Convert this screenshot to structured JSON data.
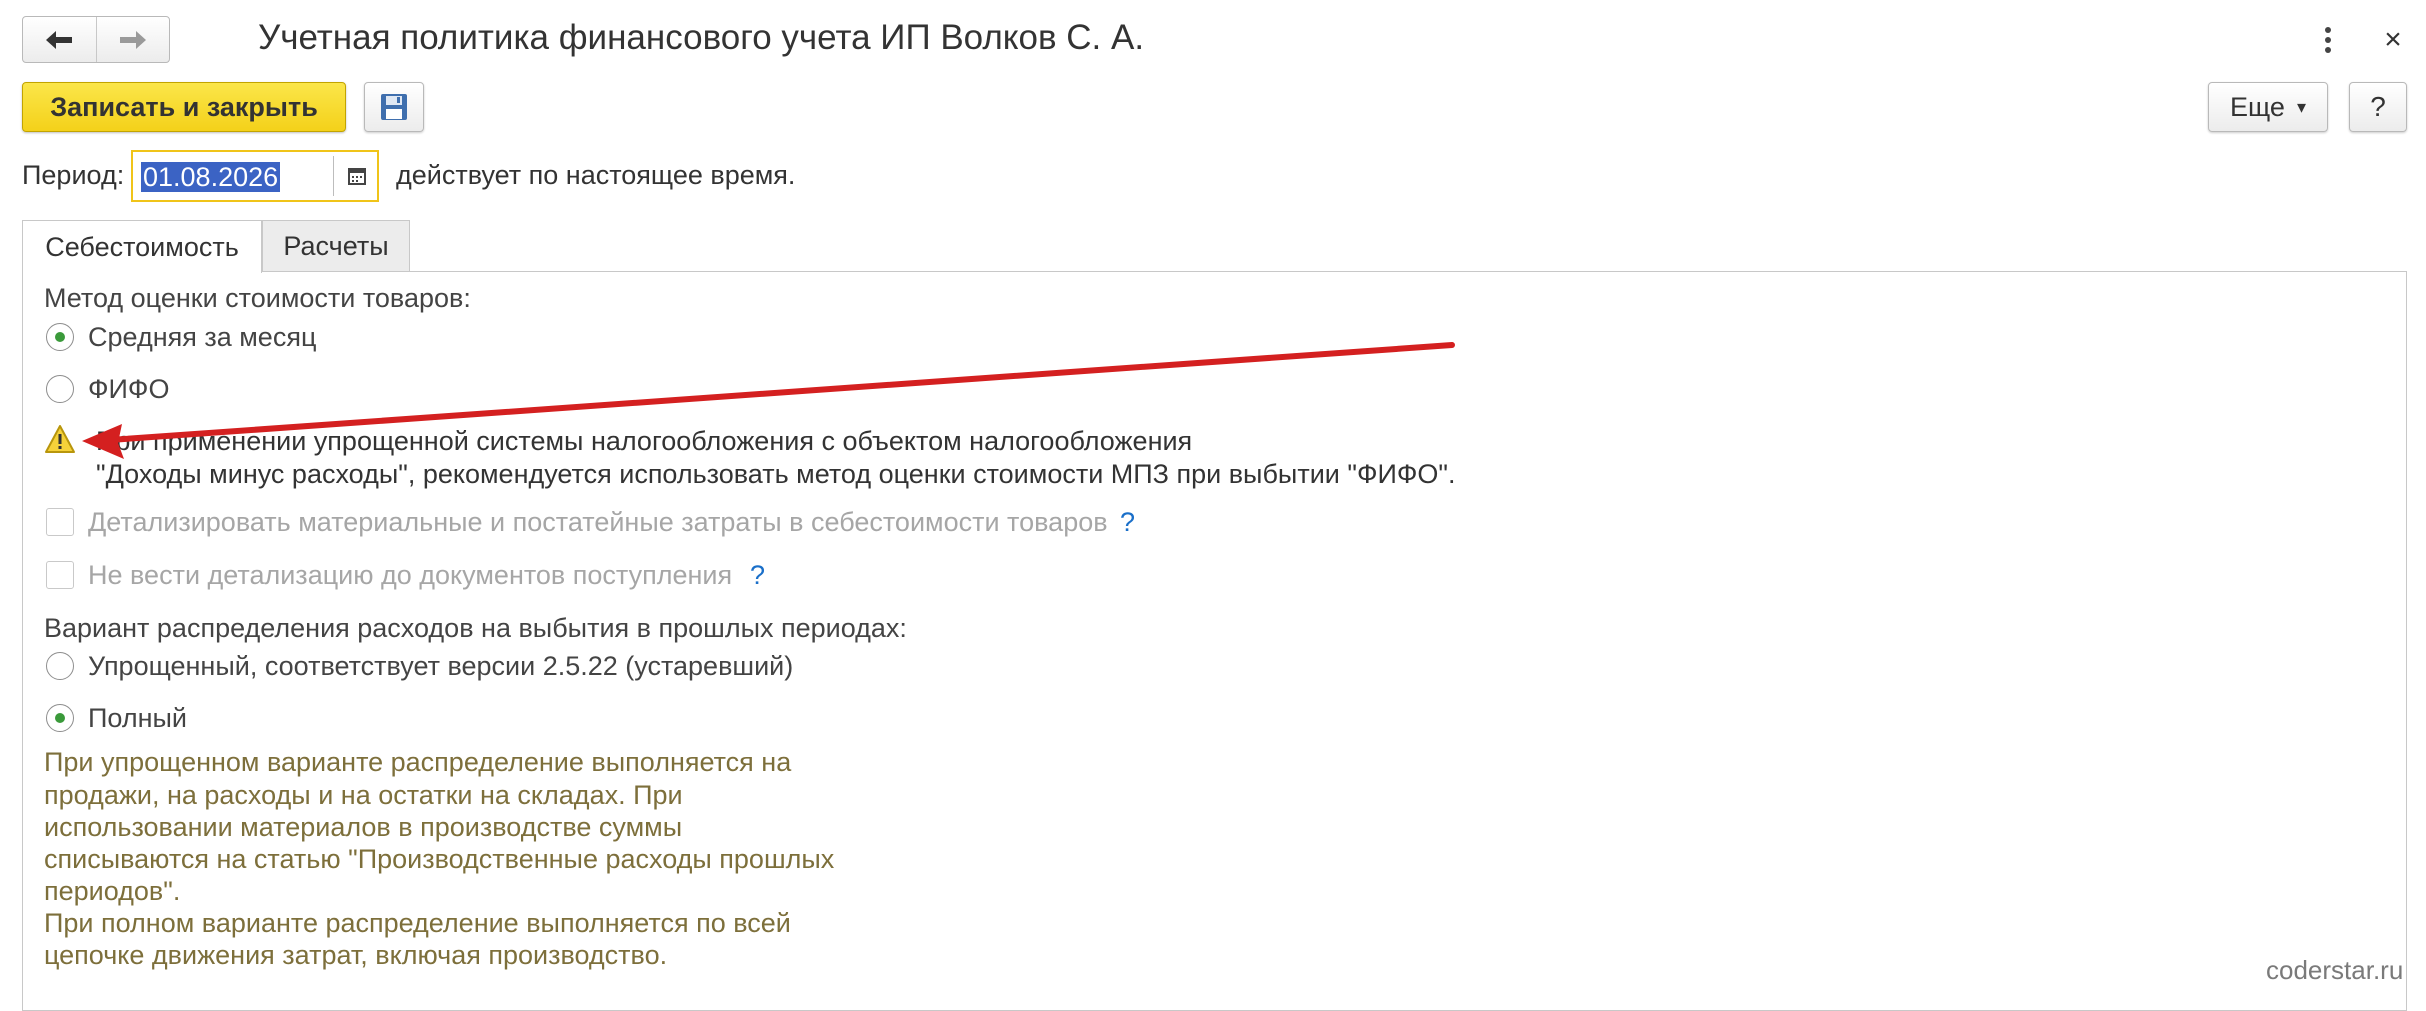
{
  "window": {
    "title": "Учетная политика финансового учета ИП Волков С. А.",
    "close_glyph": "×"
  },
  "toolbar": {
    "save_close_label": "Записать и закрыть",
    "more_label": "Еще",
    "more_arrow": "▾",
    "help_label": "?"
  },
  "period": {
    "label": "Период:",
    "value": "01.08.2026",
    "status_text": "действует по настоящее время."
  },
  "tabs": [
    {
      "label": "Себестоимость",
      "active": true
    },
    {
      "label": "Расчеты",
      "active": false
    }
  ],
  "cost": {
    "method_label": "Метод оценки стоимости товаров:",
    "options": [
      {
        "label": "Средняя за месяц",
        "selected": true
      },
      {
        "label": "ФИФО",
        "selected": false
      }
    ],
    "warning_line1": "При применении упрощенной системы налогообложения с объектом налогообложения",
    "warning_line2": "\"Доходы минус расходы\", рекомендуется использовать метод оценки стоимости МПЗ при выбытии \"ФИФО\".",
    "detail_costs_label": "Детализировать материальные и постатейные затраты в себестоимости товаров",
    "no_detail_label": "Не вести детализацию до документов поступления",
    "hint_glyph": "?",
    "distribution_label": "Вариант распределения расходов на выбытия в прошлых периодах:",
    "distribution_options": [
      {
        "label": "Упрощенный, соответствует версии 2.5.22 (устаревший)",
        "selected": false
      },
      {
        "label": "Полный",
        "selected": true
      }
    ],
    "note_lines": [
      "При упрощенном варианте распределение выполняется на",
      "продажи, на расходы и на остатки на складах. При",
      "использовании материалов в производстве суммы",
      "списываются на статью \"Производственные расходы прошлых",
      "периодов\".",
      "При полном варианте распределение выполняется по всей",
      "цепочке движения затрат, включая производство."
    ]
  },
  "watermark": "coderstar.ru",
  "colors": {
    "primary_button": "#f4d11a",
    "selection": "#3b63c4",
    "radio_dot": "#3a9a3a",
    "hint": "#1a6fc9",
    "note_text": "#7d6f3b",
    "annotation_arrow": "#d42020"
  }
}
